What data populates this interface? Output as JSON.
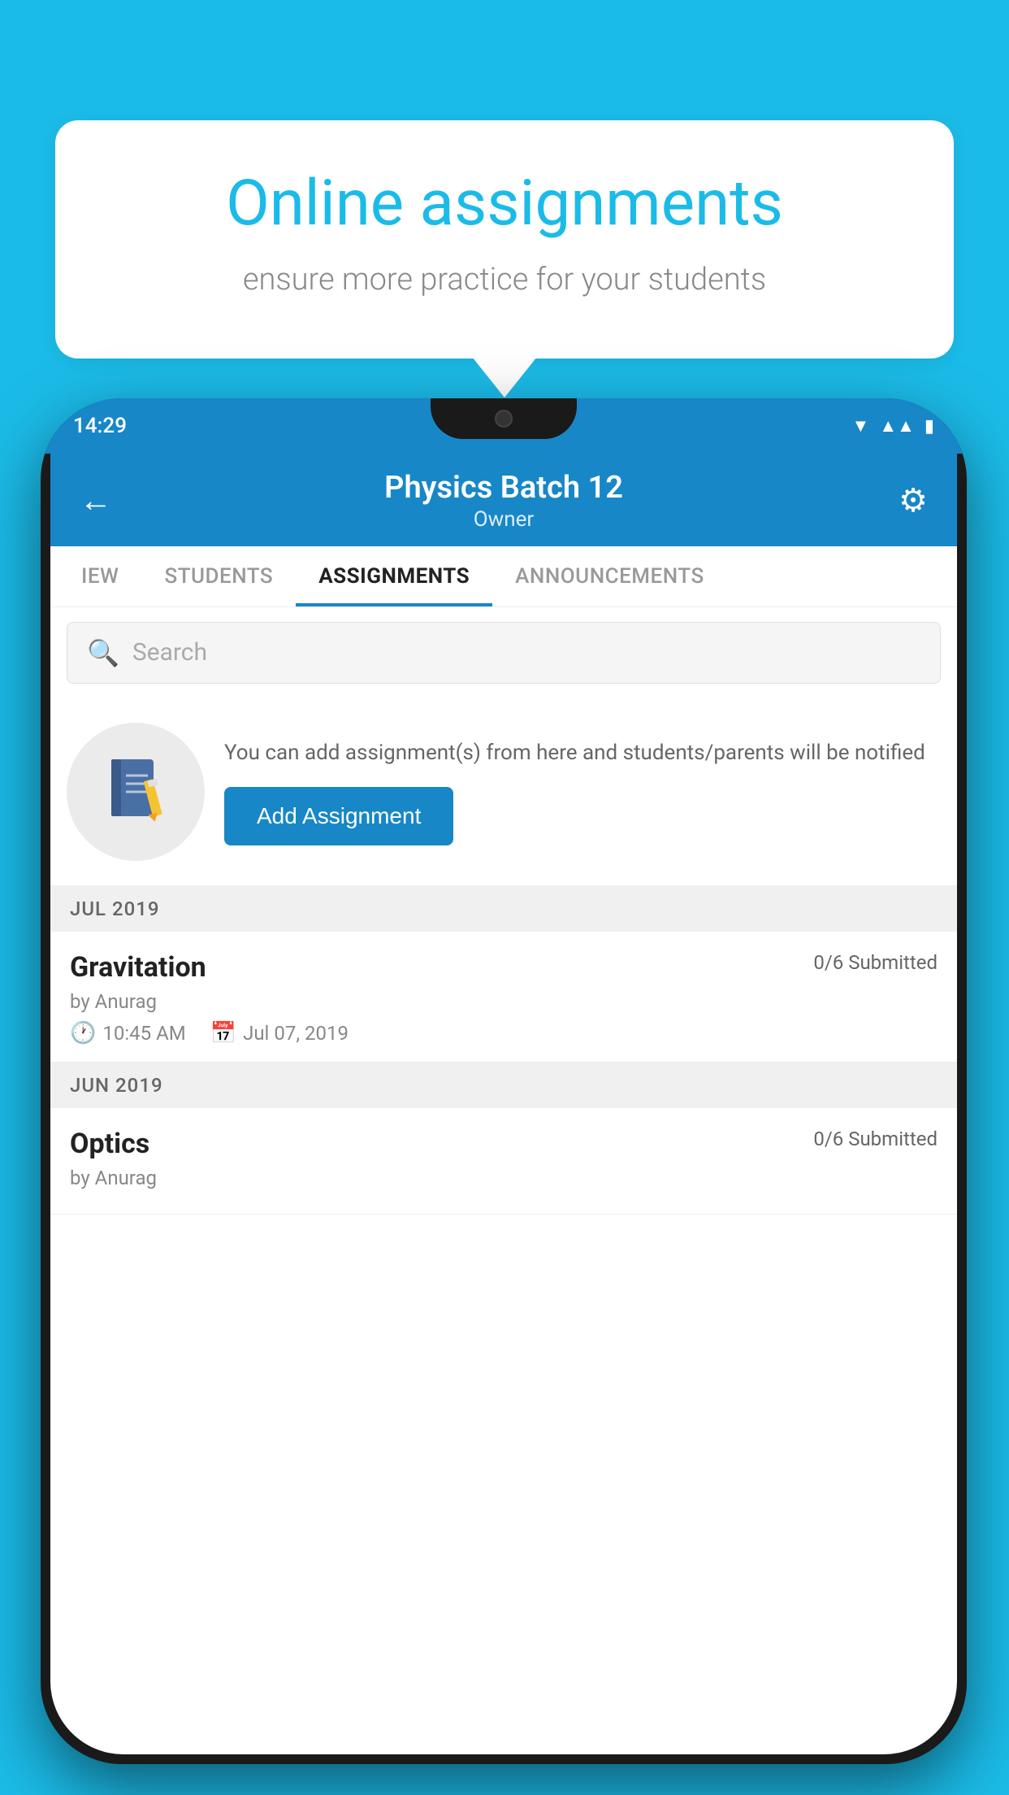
{
  "background_color": "#1BBBE8",
  "speech_bubble": {
    "heading": "Online assignments",
    "subtext": "ensure more practice for your students"
  },
  "status_bar": {
    "time": "14:29",
    "icons": [
      "wifi",
      "signal",
      "battery"
    ]
  },
  "app_header": {
    "title": "Physics Batch 12",
    "subtitle": "Owner",
    "back_label": "←",
    "settings_label": "⚙"
  },
  "tabs": [
    {
      "label": "IEW",
      "active": false
    },
    {
      "label": "STUDENTS",
      "active": false
    },
    {
      "label": "ASSIGNMENTS",
      "active": true
    },
    {
      "label": "ANNOUNCEMENTS",
      "active": false
    }
  ],
  "search": {
    "placeholder": "Search"
  },
  "promo": {
    "text": "You can add assignment(s) from here and students/parents will be notified",
    "button_label": "Add Assignment"
  },
  "sections": [
    {
      "month": "JUL 2019",
      "assignments": [
        {
          "title": "Gravitation",
          "submitted": "0/6 Submitted",
          "by": "by Anurag",
          "time": "10:45 AM",
          "date": "Jul 07, 2019"
        }
      ]
    },
    {
      "month": "JUN 2019",
      "assignments": [
        {
          "title": "Optics",
          "submitted": "0/6 Submitted",
          "by": "by Anurag",
          "time": "",
          "date": ""
        }
      ]
    }
  ]
}
